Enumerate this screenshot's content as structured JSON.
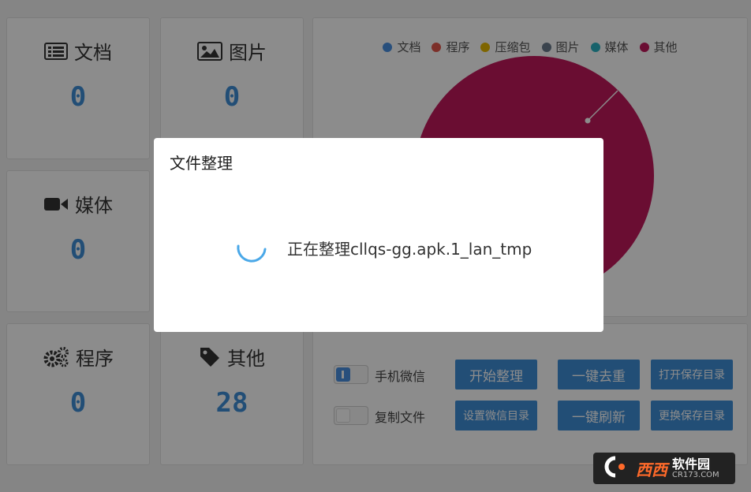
{
  "stats": [
    {
      "label": "文档",
      "value": "0",
      "icon": "document-icon"
    },
    {
      "label": "图片",
      "value": "0",
      "icon": "image-icon"
    },
    {
      "label": "媒体",
      "value": "0",
      "icon": "video-icon"
    },
    {
      "label": "程序",
      "value": "0",
      "icon": "gears-icon"
    },
    {
      "label": "其他",
      "value": "28",
      "icon": "tag-icon"
    }
  ],
  "legend": [
    {
      "label": "文档",
      "color": "#4a90e2"
    },
    {
      "label": "程序",
      "color": "#e2574c"
    },
    {
      "label": "压缩包",
      "color": "#e6b800"
    },
    {
      "label": "图片",
      "color": "#6b7b8c"
    },
    {
      "label": "媒体",
      "color": "#2ab3c4"
    },
    {
      "label": "其他",
      "color": "#c2185b"
    }
  ],
  "options": {
    "wechat_label": "手机微信",
    "wechat_on": true,
    "copy_label": "复制文件",
    "copy_on": false
  },
  "buttons": {
    "start": "开始整理",
    "dedupe": "一键去重",
    "open_dir": "打开保存目录",
    "set_wechat": "设置微信目录",
    "refresh": "一键刷新",
    "change_dir": "更换保存目录"
  },
  "dialog": {
    "title": "文件整理",
    "message": "正在整理cllqs-gg.apk.1_lan_tmp"
  },
  "watermark": {
    "brand": "西西",
    "name": "软件园",
    "site": "CR173.COM"
  }
}
